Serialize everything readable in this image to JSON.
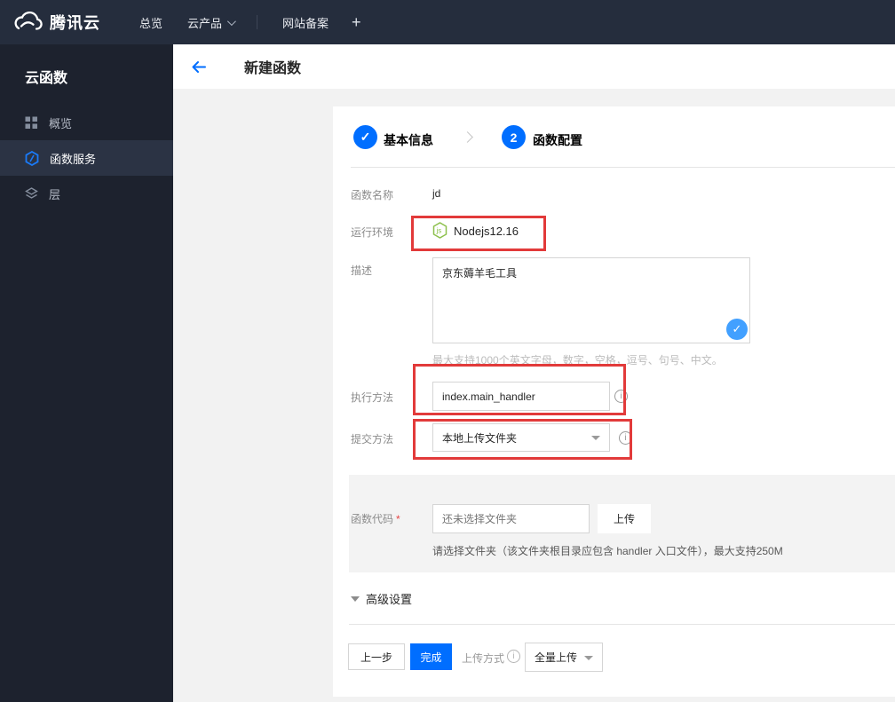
{
  "colors": {
    "navbar_bg": "#252d3d",
    "sidebar_bg": "#1d222e",
    "sidebar_active_bg": "#2b3344",
    "primary_blue": "#006eff",
    "bubble_blue": "#42a0ff",
    "annotation_red": "#e23a3a",
    "nodejs_green": "#8cc04b",
    "content_bg": "#f2f2f2"
  },
  "navbar": {
    "brand": "腾讯云",
    "menu": [
      {
        "label": "总览"
      },
      {
        "label": "云产品"
      },
      {
        "label": "网站备案"
      },
      {
        "label": "+"
      }
    ]
  },
  "sidebar": {
    "title": "云函数",
    "items": [
      {
        "label": "概览",
        "icon": "grid-icon",
        "active": false
      },
      {
        "label": "函数服务",
        "icon": "function-hexagon-icon",
        "active": true
      },
      {
        "label": "层",
        "icon": "layers-icon",
        "active": false
      }
    ]
  },
  "header": {
    "title": "新建函数"
  },
  "steps": {
    "step1_label": "基本信息",
    "step2_number": "2",
    "step2_label": "函数配置",
    "check_glyph": "✓"
  },
  "form": {
    "name_label": "函数名称",
    "name_value": "jd",
    "runtime_label": "运行环境",
    "runtime_value": "Nodejs12.16",
    "desc_label": "描述",
    "desc_value": "京东薅羊毛工具",
    "desc_hint": "最大支持1000个英文字母，数字，空格，逗号、句号、中文。",
    "handler_label": "执行方法",
    "handler_value": "index.main_handler",
    "submit_label": "提交方法",
    "submit_value": "本地上传文件夹",
    "code_label": "函数代码",
    "required_mark": "*",
    "code_placeholder": "还未选择文件夹",
    "upload_button": "上传",
    "code_hint": "请选择文件夹（该文件夹根目录应包含 handler 入口文件），最大支持250M",
    "advanced_label": "高级设置",
    "info_glyph": "i",
    "ok_glyph": "✓"
  },
  "footer": {
    "prev_button": "上一步",
    "finish_button": "完成",
    "upload_mode_label": "上传方式",
    "upload_mode_value": "全量上传"
  }
}
